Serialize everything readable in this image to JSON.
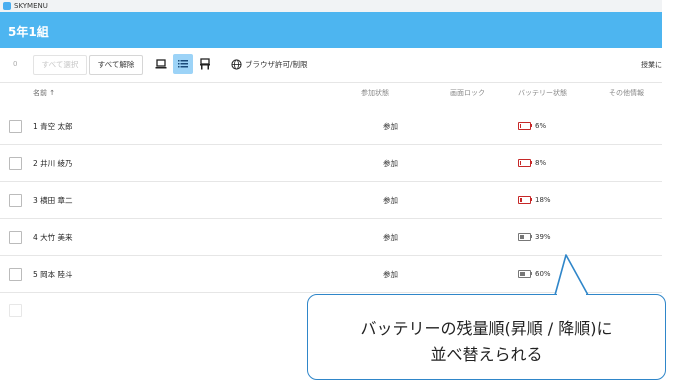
{
  "app": {
    "name": "SKYMENU"
  },
  "header": {
    "class_name": "5年1組"
  },
  "toolbar": {
    "count": "0",
    "select_all_label": "すべて選択",
    "deselect_all_label": "すべて解除",
    "browser_label": "ブラウザ許可/制限",
    "right_label": "授業に"
  },
  "columns": {
    "name": "名前 ↑",
    "participation": "参加状態",
    "screen_lock": "画面ロック",
    "battery": "バッテリー状態",
    "other": "その他情報"
  },
  "students": [
    {
      "name": "1 青空 太郎",
      "status": "参加",
      "battery_pct": 6,
      "battery_label": "6%",
      "battery_color": "#c62828"
    },
    {
      "name": "2 井川 綾乃",
      "status": "参加",
      "battery_pct": 8,
      "battery_label": "8%",
      "battery_color": "#c62828"
    },
    {
      "name": "3 横田 章二",
      "status": "参加",
      "battery_pct": 18,
      "battery_label": "18%",
      "battery_color": "#c62828"
    },
    {
      "name": "4 大竹 美来",
      "status": "参加",
      "battery_pct": 39,
      "battery_label": "39%",
      "battery_color": "#777777"
    },
    {
      "name": "5 岡本 陸斗",
      "status": "参加",
      "battery_pct": 60,
      "battery_label": "60%",
      "battery_color": "#777777"
    }
  ],
  "callout": {
    "line1": "バッテリーの残量順(昇順 / 降順)に",
    "line2": "並べ替えられる"
  },
  "colors": {
    "header": "#4db5f0",
    "active_view": "#9cd3f7",
    "low_battery": "#c62828",
    "callout_border": "#2f86c9"
  }
}
